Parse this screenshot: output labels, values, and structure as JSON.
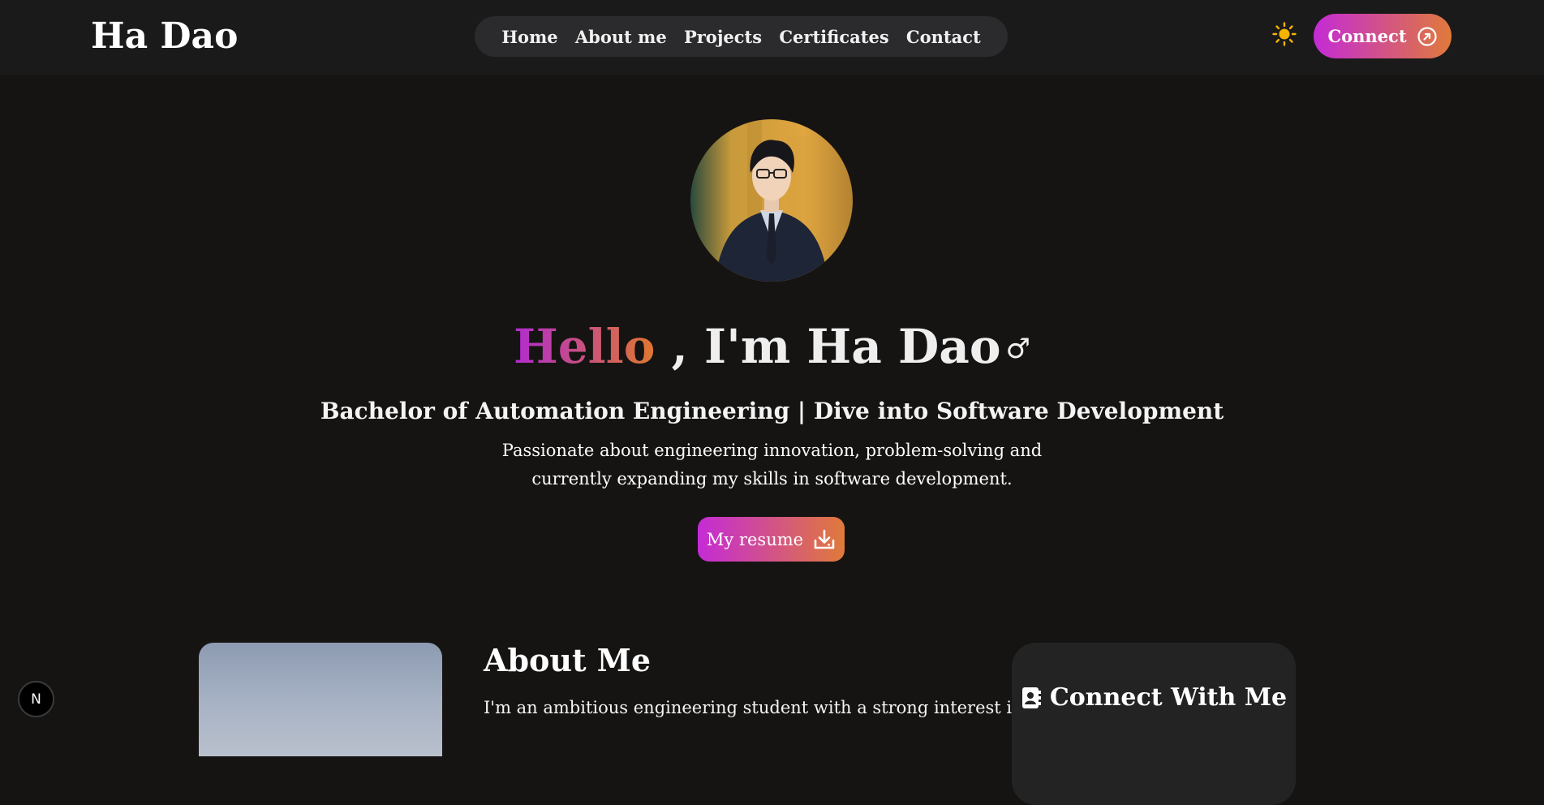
{
  "header": {
    "logo": "Ha Dao",
    "nav": [
      "Home",
      "About me",
      "Projects",
      "Certificates",
      "Contact"
    ],
    "theme_icon": "sun-icon",
    "connect_label": "Connect",
    "connect_icon": "arrow-up-right-circle-icon"
  },
  "hero": {
    "avatar_icon": "profile-photo",
    "greeting": "Hello",
    "title_rest": " , I'm Ha Dao",
    "title_symbol": "♂",
    "subtitle": "Bachelor of Automation Engineering | Dive into Software Development",
    "description_lines": [
      "Passionate about engineering innovation, problem-solving and",
      "currently expanding my skills in software development."
    ],
    "resume_label": "My resume",
    "resume_icon": "download-icon"
  },
  "about": {
    "title": "About Me",
    "text_line1": "I'm an ambitious engineering student with a strong interest in"
  },
  "connect_card": {
    "title": "Connect With Me",
    "icon": "contact-book-icon"
  },
  "badge": {
    "letter": "N"
  },
  "colors": {
    "background": "#161412",
    "header": "#1b1a1b",
    "nav_pill": "#2b2a2c",
    "gradient_start": "#c42bd6",
    "gradient_end": "#e07a3a",
    "sun": "#f5b400",
    "card": "#242323"
  }
}
